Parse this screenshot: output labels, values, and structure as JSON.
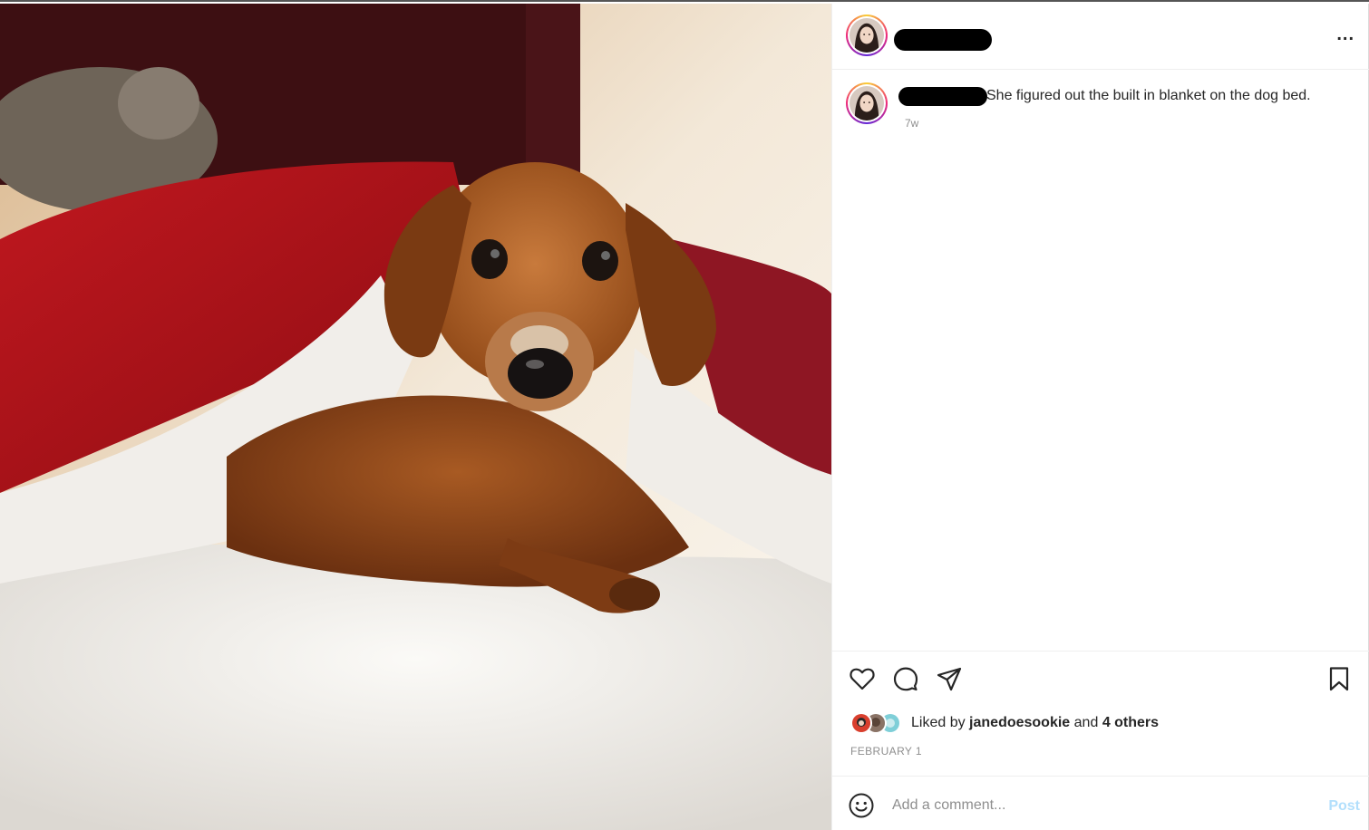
{
  "post": {
    "image": {
      "icon": "photo-dachshund-under-blanket",
      "description_colors": {
        "blanket_red": "#b3151c",
        "fleece_white": "#f4f2ee",
        "dog_brown": "#8a4418"
      }
    },
    "header": {
      "avatar_icon": "profile-avatar-icon",
      "username_redacted": true,
      "more_label": "..."
    },
    "caption": {
      "avatar_icon": "profile-avatar-icon",
      "username_redacted": true,
      "text": "She figured out the built in blanket on the dog bed.",
      "time": "7w"
    },
    "actions": {
      "like_icon": "heart-icon",
      "comment_icon": "comment-icon",
      "share_icon": "share-icon",
      "save_icon": "bookmark-icon"
    },
    "likes": {
      "prefix": "Liked by",
      "user": "janedoesookie",
      "and": "and",
      "others": "4 others"
    },
    "date": "FEBRUARY 1",
    "comment": {
      "emoji_icon": "emoji-icon",
      "placeholder": "Add a comment...",
      "post_label": "Post"
    },
    "colors": {
      "text": "#262626",
      "muted": "#8e8e8e",
      "post_button": "#b2dffc",
      "border": "#efefef"
    }
  }
}
